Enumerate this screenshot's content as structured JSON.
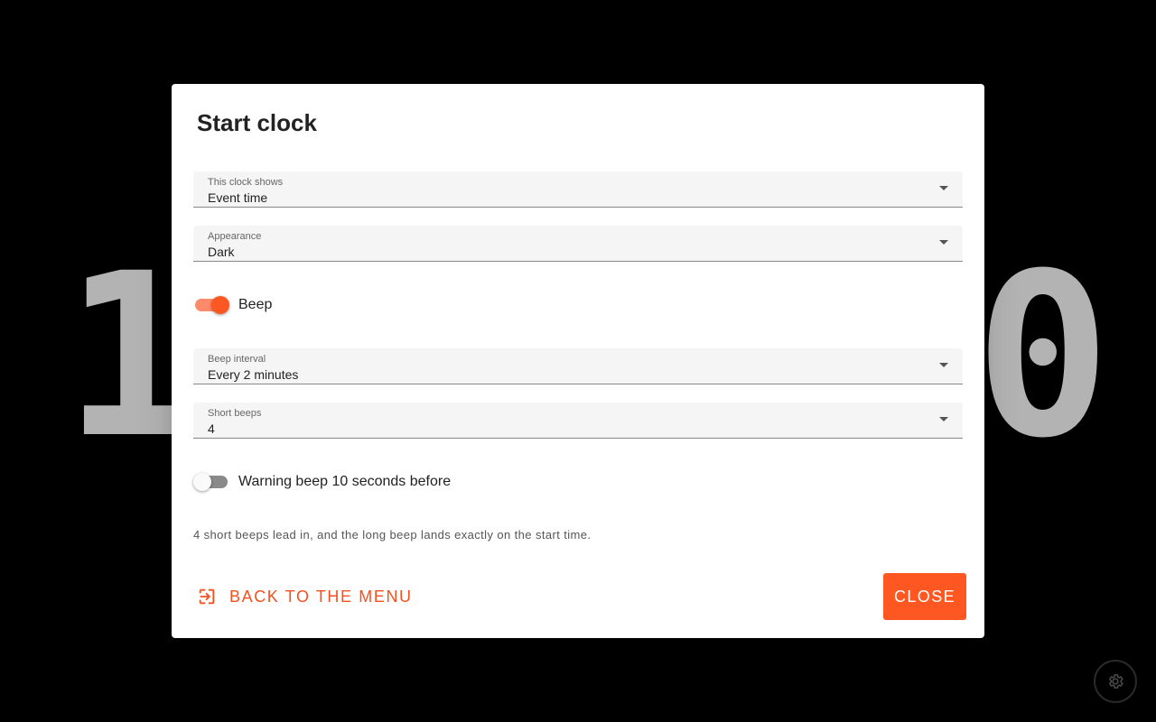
{
  "background_clock": {
    "left_digit": "1",
    "right_digit": "0"
  },
  "dialog": {
    "title": "Start clock",
    "fields": [
      {
        "label": "This clock shows",
        "value": "Event time"
      },
      {
        "label": "Appearance",
        "value": "Dark"
      },
      {
        "label": "Beep interval",
        "value": "Every 2 minutes"
      },
      {
        "label": "Short beeps",
        "value": "4"
      }
    ],
    "toggles": [
      {
        "label": "Beep",
        "checked": true
      },
      {
        "label": "Warning beep 10 seconds before",
        "checked": false
      }
    ],
    "info": "4 short beeps lead in, and the long beep lands exactly on the start time.",
    "back_label": "Back to the menu",
    "close_label": "CLOSE"
  },
  "icons": {
    "back": "exit-to-app-icon",
    "settings": "gear-icon",
    "dropdown": "chevron-down-icon"
  },
  "colors": {
    "accent": "#ff5722",
    "accent_text": "#f4511e",
    "clock_digits": "#b3b3b3"
  }
}
